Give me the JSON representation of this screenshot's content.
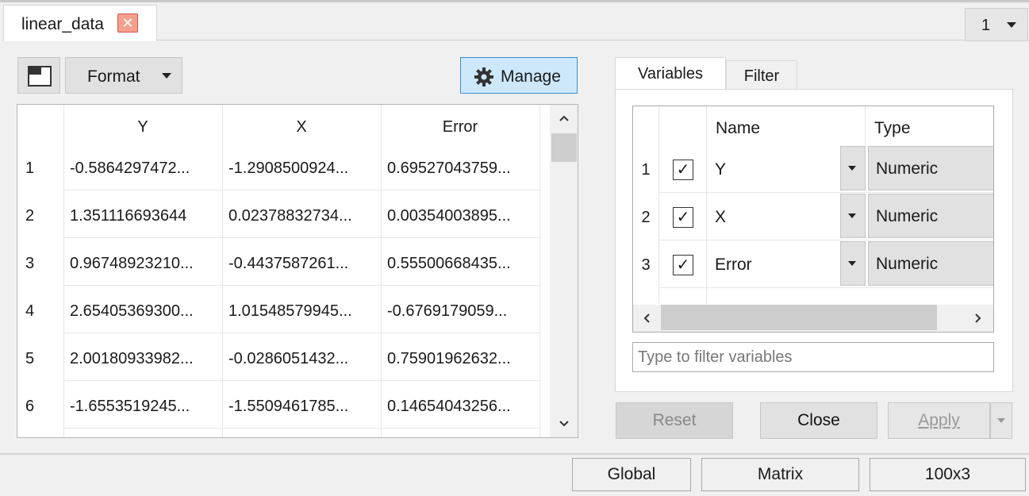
{
  "document_tab": {
    "title": "linear_data",
    "close_symbol": "✕"
  },
  "page_select": {
    "value": "1"
  },
  "toolbar": {
    "format_label": "Format",
    "manage_label": "Manage"
  },
  "table": {
    "columns": [
      "Y",
      "X",
      "Error"
    ],
    "rows": [
      {
        "num": "1",
        "cells": [
          "-0.5864297472...",
          "-1.2908500924...",
          "0.69527043759..."
        ]
      },
      {
        "num": "2",
        "cells": [
          "1.351116693644",
          "0.02378832734...",
          "0.00354003895..."
        ]
      },
      {
        "num": "3",
        "cells": [
          "0.96748923210...",
          "-0.4437587261...",
          "0.55500668435..."
        ]
      },
      {
        "num": "4",
        "cells": [
          "2.65405369300...",
          "1.01548579945...",
          "-0.6769179059..."
        ]
      },
      {
        "num": "5",
        "cells": [
          "2.00180933982...",
          "-0.0286051432...",
          "0.75901962632..."
        ]
      },
      {
        "num": "6",
        "cells": [
          "-1.6553519245...",
          "-1.5509461785...",
          "0.14654043256..."
        ]
      }
    ]
  },
  "right_tabs": [
    "Variables",
    "Filter"
  ],
  "variables": {
    "headers": {
      "name": "Name",
      "type": "Type"
    },
    "items": [
      {
        "num": "1",
        "checked": "✓",
        "name": "Y",
        "type": "Numeric"
      },
      {
        "num": "2",
        "checked": "✓",
        "name": "X",
        "type": "Numeric"
      },
      {
        "num": "3",
        "checked": "✓",
        "name": "Error",
        "type": "Numeric"
      }
    ],
    "filter_placeholder": "Type to filter variables"
  },
  "buttons": {
    "reset": "Reset",
    "close": "Close",
    "apply": "Apply"
  },
  "status": {
    "scope": "Global",
    "kind": "Matrix",
    "size": "100x3"
  },
  "colors": {
    "manage_bg": "#cde8fb",
    "manage_border": "#3d8fd1",
    "close_icon": "#f3a08e"
  }
}
